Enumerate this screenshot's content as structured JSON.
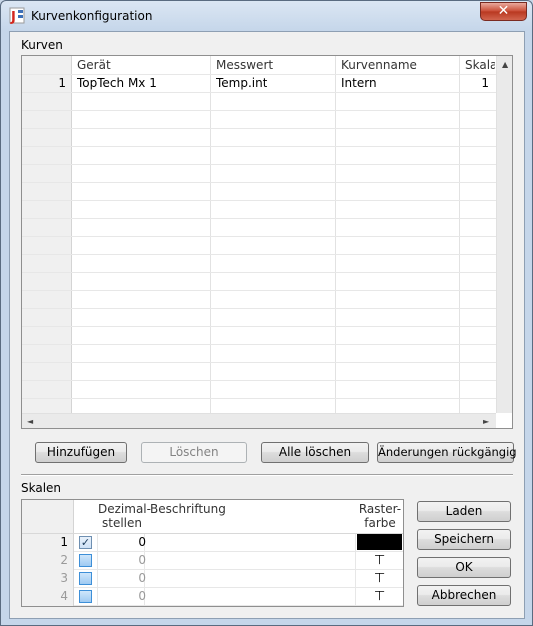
{
  "window": {
    "title": "Kurvenkonfiguration",
    "close_label": "✕"
  },
  "kurven": {
    "label": "Kurven",
    "columns": [
      "Gerät",
      "Messwert",
      "Kurvenname",
      "Skala"
    ],
    "rows": [
      {
        "num": "1",
        "geraet": "TopTech Mx 1",
        "messwert": "Temp.int",
        "kurvenname": "Intern",
        "skala": "1"
      }
    ]
  },
  "buttons": {
    "add": "Hinzufügen",
    "delete": "Löschen",
    "delete_all": "Alle löschen",
    "undo": "Änderungen rückgängig",
    "load": "Laden",
    "save": "Speichern",
    "ok": "OK",
    "cancel": "Abbrechen"
  },
  "skalen": {
    "label": "Skalen",
    "columns": {
      "decimals_line1": "Dezimal-",
      "decimals_line2": "stellen",
      "caption": "Beschriftung",
      "color_line1": "Raster-",
      "color_line2": "farbe"
    },
    "rows": [
      {
        "num": "1",
        "checked": true,
        "decimals": "0",
        "color": "#000000"
      },
      {
        "num": "2",
        "checked": false,
        "decimals": "0"
      },
      {
        "num": "3",
        "checked": false,
        "decimals": "0"
      },
      {
        "num": "4",
        "checked": false,
        "decimals": "0"
      }
    ],
    "checkmark": "✓",
    "tee_glyph": "⊤"
  },
  "scroll": {
    "up": "▲",
    "left": "◄",
    "right": "►"
  },
  "icons": {
    "app": "app-logo-icon",
    "close": "close-icon",
    "checkbox": "checkbox-icon"
  }
}
